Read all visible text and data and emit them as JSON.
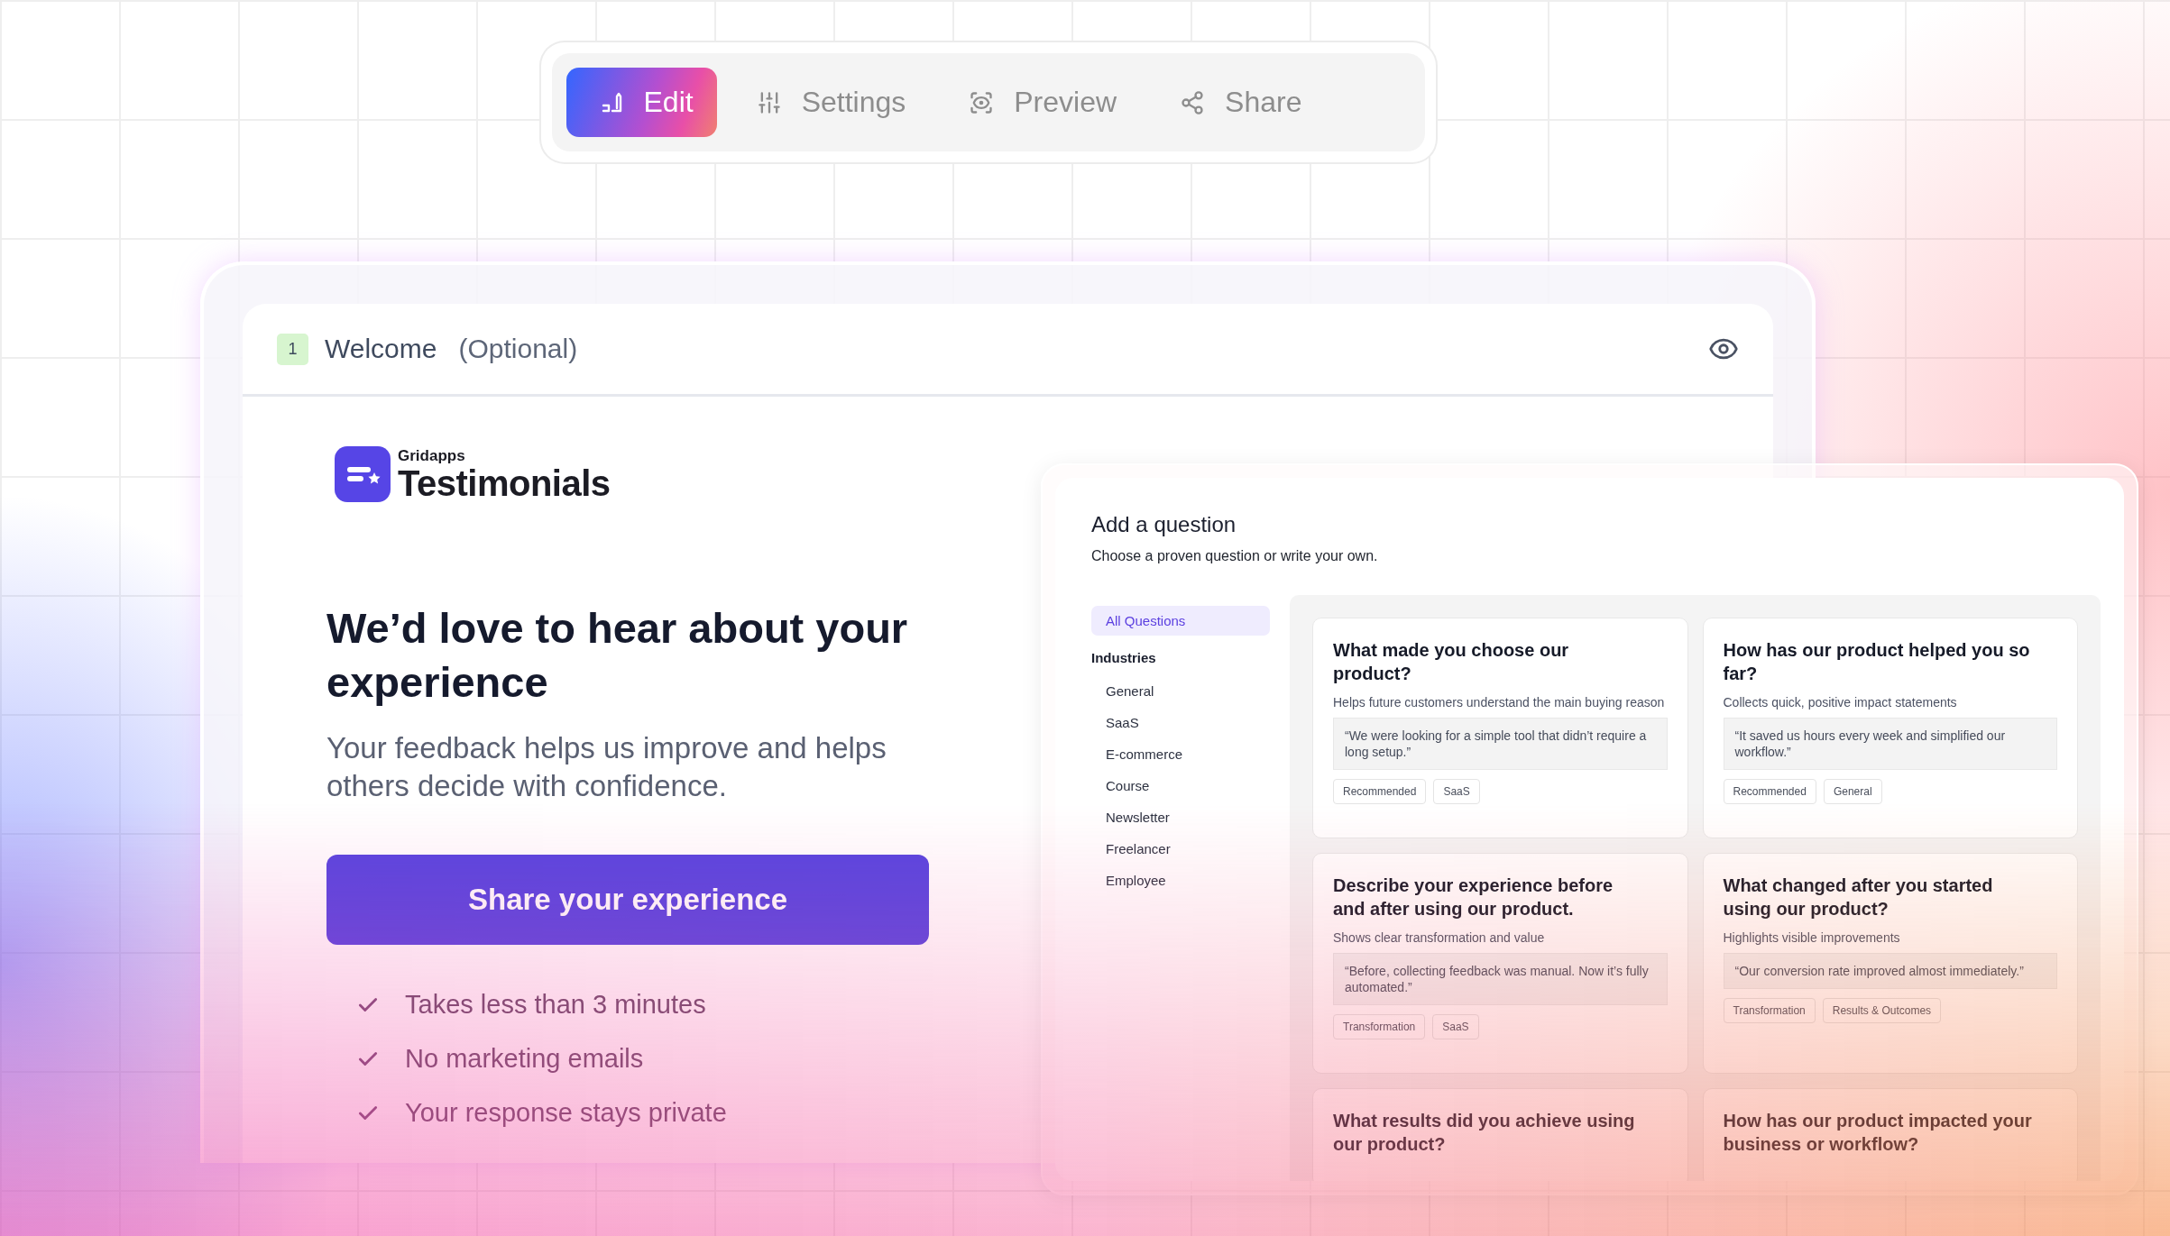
{
  "toolbar": {
    "tabs": [
      {
        "label": "Edit",
        "selected": true
      },
      {
        "label": "Settings",
        "selected": false
      },
      {
        "label": "Preview",
        "selected": false
      },
      {
        "label": "Share",
        "selected": false
      }
    ]
  },
  "step": {
    "number": "1",
    "title": "Welcome",
    "note": "(Optional)"
  },
  "brand": {
    "overline": "Gridapps",
    "name": "Testimonials"
  },
  "hero": {
    "heading": "We’d love to hear about your experience",
    "subheading": "Your feedback helps us improve and helps others decide with confidence.",
    "button": "Share your experience",
    "points": [
      "Takes less than 3 minutes",
      "No marketing emails",
      "Your response stays private"
    ]
  },
  "question_panel": {
    "title": "Add a question",
    "subtitle": "Choose a proven question or write your own.",
    "sidebar": {
      "top_items": [
        {
          "label": "All Questions",
          "selected": true
        }
      ],
      "group_title": "Industries",
      "group_items": [
        {
          "label": "General",
          "selected": false
        },
        {
          "label": "SaaS",
          "selected": false
        },
        {
          "label": "E-commerce",
          "selected": false
        },
        {
          "label": "Course",
          "selected": false
        },
        {
          "label": "Newsletter",
          "selected": false
        },
        {
          "label": "Freelancer",
          "selected": false
        },
        {
          "label": "Employee",
          "selected": false
        }
      ]
    },
    "cards": [
      {
        "title": "What made you choose our product?",
        "description": "Helps future customers understand the main buying reason",
        "example": "“We were looking for a simple tool that didn’t require a long setup.”",
        "tags": [
          "Recommended",
          "SaaS"
        ]
      },
      {
        "title": "How has our product helped you so far?",
        "description": "Collects quick, positive impact statements",
        "example": "“It saved us hours every week and simplified our workflow.”",
        "tags": [
          "Recommended",
          "General"
        ]
      },
      {
        "title": "Describe your experience before and after using our product.",
        "description": "Shows clear transformation and value",
        "example": "“Before, collecting feedback was manual. Now it’s fully automated.”",
        "tags": [
          "Transformation",
          "SaaS"
        ]
      },
      {
        "title": "What changed after you started using our product?",
        "description": "Highlights visible improvements",
        "example": "“Our conversion rate improved almost immediately.”",
        "tags": [
          "Transformation",
          "Results & Outcomes"
        ]
      },
      {
        "title": "What results did you achieve using our product?"
      },
      {
        "title": "How has our product impacted your business or workflow?"
      }
    ]
  }
}
